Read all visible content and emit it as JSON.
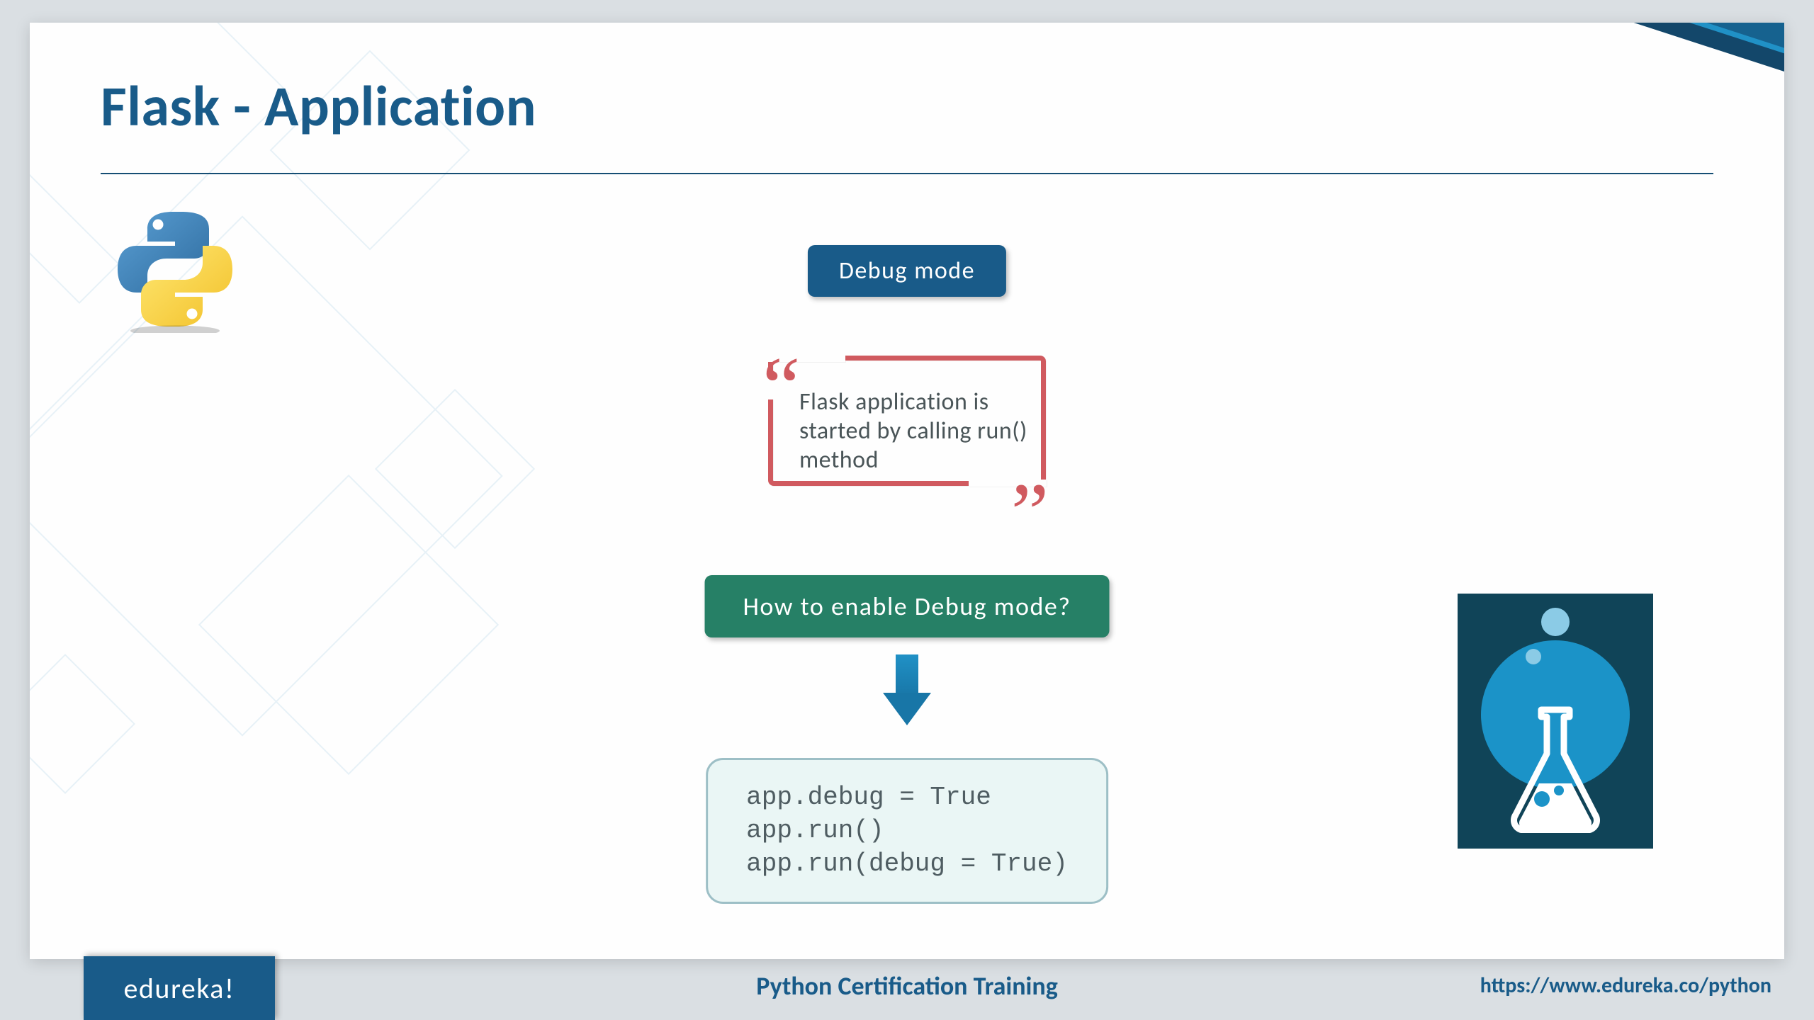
{
  "title": "Flask - Application",
  "badge1": "Debug mode",
  "quote": "Flask application is started by calling run() method",
  "badge2": "How to enable Debug mode?",
  "code": "app.debug = True\napp.run()\napp.run(debug = True)",
  "footer": {
    "brand": "edureka!",
    "center": "Python Certification Training",
    "url": "https://www.edureka.co/python"
  }
}
